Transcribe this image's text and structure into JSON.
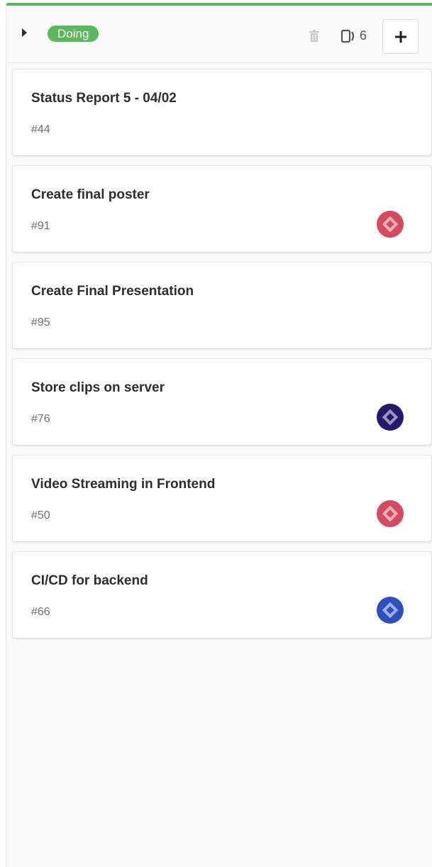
{
  "header": {
    "list_label": "Doing",
    "label_color": "#5bb85d",
    "issue_count": "6",
    "icons": [
      "caret-right-icon",
      "trash-icon",
      "issues-icon",
      "plus-icon"
    ]
  },
  "cards": [
    {
      "title": "Status Report 5 - 04/02",
      "number": "#44",
      "avatar": null
    },
    {
      "title": "Create final poster",
      "number": "#91",
      "avatar": "identicon-red"
    },
    {
      "title": "Create Final Presentation",
      "number": "#95",
      "avatar": null
    },
    {
      "title": "Store clips on server",
      "number": "#76",
      "avatar": "identicon-navy"
    },
    {
      "title": "Video Streaming in Frontend",
      "number": "#50",
      "avatar": "identicon-red"
    },
    {
      "title": "CI/CD for backend",
      "number": "#66",
      "avatar": "identicon-blue"
    }
  ],
  "avatar_colors": {
    "identicon-red": "#d44a5e",
    "identicon-navy": "#27186b",
    "identicon-blue": "#2f4fc0"
  }
}
